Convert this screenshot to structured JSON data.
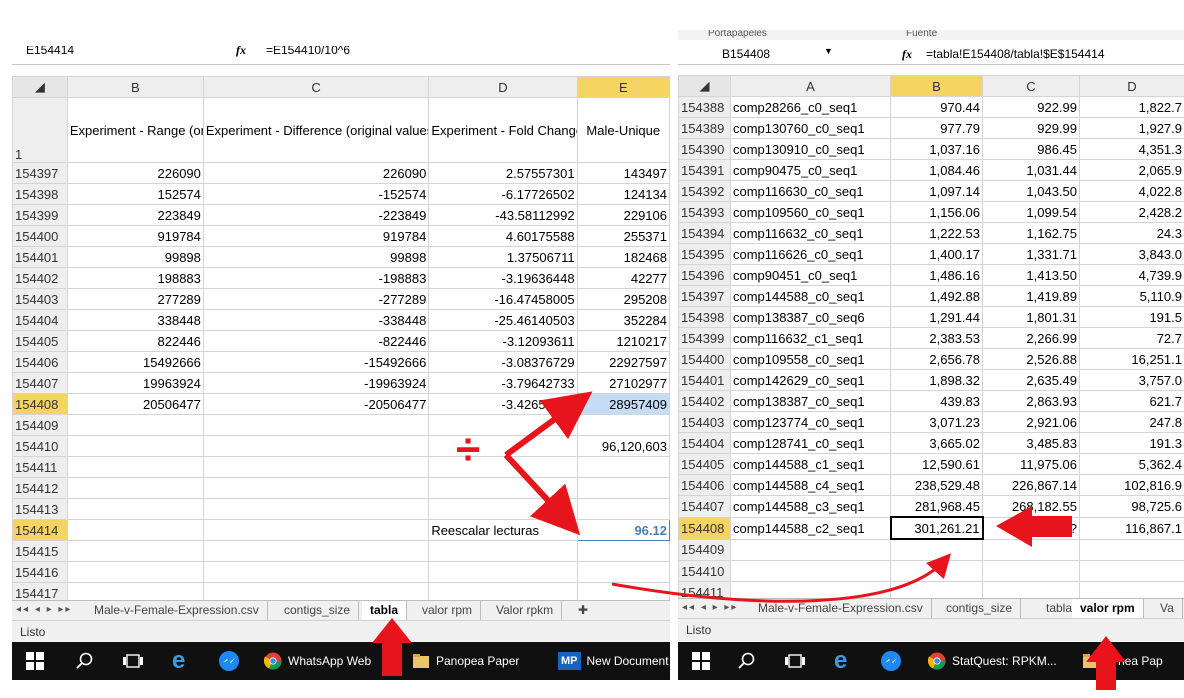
{
  "left": {
    "namebox": "E154414",
    "formula": "=E154410/10^6",
    "columns": [
      "B",
      "C",
      "D",
      "E"
    ],
    "header_row": {
      "num": "1",
      "B": "Experiment - Range (original values)",
      "C": "Experiment - Difference (original values)",
      "D": "Experiment - Fold Change (original values)",
      "E": "Male-Unique"
    },
    "rows": [
      {
        "n": "154397",
        "B": "226090",
        "C": "226090",
        "D": "2.57557301",
        "E": "143497"
      },
      {
        "n": "154398",
        "B": "152574",
        "C": "-152574",
        "D": "-6.17726502",
        "E": "124134"
      },
      {
        "n": "154399",
        "B": "223849",
        "C": "-223849",
        "D": "-43.58112992",
        "E": "229106"
      },
      {
        "n": "154400",
        "B": "919784",
        "C": "919784",
        "D": "4.60175588",
        "E": "255371"
      },
      {
        "n": "154401",
        "B": "99898",
        "C": "99898",
        "D": "1.37506711",
        "E": "182468"
      },
      {
        "n": "154402",
        "B": "198883",
        "C": "-198883",
        "D": "-3.19636448",
        "E": "42277"
      },
      {
        "n": "154403",
        "B": "277289",
        "C": "-277289",
        "D": "-16.47458005",
        "E": "295208"
      },
      {
        "n": "154404",
        "B": "338448",
        "C": "-338448",
        "D": "-25.46140503",
        "E": "352284"
      },
      {
        "n": "154405",
        "B": "822446",
        "C": "-822446",
        "D": "-3.12093611",
        "E": "1210217"
      },
      {
        "n": "154406",
        "B": "15492666",
        "C": "-15492666",
        "D": "-3.08376729",
        "E": "22927597"
      },
      {
        "n": "154407",
        "B": "19963924",
        "C": "-19963924",
        "D": "-3.79642733",
        "E": "27102977"
      },
      {
        "n": "154408",
        "B": "20506477",
        "C": "-20506477",
        "D": "-3.42653438",
        "E": "28957409"
      },
      {
        "n": "154409",
        "B": "",
        "C": "",
        "D": "",
        "E": ""
      },
      {
        "n": "154410",
        "B": "",
        "C": "",
        "D": "",
        "E": "96,120,603"
      },
      {
        "n": "154411",
        "B": "",
        "C": "",
        "D": "",
        "E": ""
      },
      {
        "n": "154412",
        "B": "",
        "C": "",
        "D": "",
        "E": ""
      },
      {
        "n": "154413",
        "B": "",
        "C": "",
        "D": "",
        "E": ""
      },
      {
        "n": "154414",
        "B": "",
        "C": "",
        "D": "Reescalar lecturas",
        "E": "96.12"
      },
      {
        "n": "154415",
        "B": "",
        "C": "",
        "D": "",
        "E": ""
      },
      {
        "n": "154416",
        "B": "",
        "C": "",
        "D": "",
        "E": ""
      },
      {
        "n": "154417",
        "B": "",
        "C": "",
        "D": "",
        "E": ""
      }
    ],
    "tabs": [
      "Male-v-Female-Expression.csv",
      "contigs_size",
      "tabla",
      "valor rpm",
      "Valor rpkm"
    ],
    "active_tab": "tabla",
    "status": "Listo",
    "divide_symbol": "÷"
  },
  "right": {
    "ribbon_labels": [
      "Portapapeles",
      "Fuente"
    ],
    "namebox": "B154408",
    "formula": "=tabla!E154408/tabla!$E$154414",
    "columns": [
      "A",
      "B",
      "C",
      "D"
    ],
    "rows": [
      {
        "n": "154388",
        "A": "comp28266_c0_seq1",
        "B": "970.44",
        "C": "922.99",
        "D": "1,822.7"
      },
      {
        "n": "154389",
        "A": "comp130760_c0_seq1",
        "B": "977.79",
        "C": "929.99",
        "D": "1,927.9"
      },
      {
        "n": "154390",
        "A": "comp130910_c0_seq1",
        "B": "1,037.16",
        "C": "986.45",
        "D": "4,351.3"
      },
      {
        "n": "154391",
        "A": "comp90475_c0_seq1",
        "B": "1,084.46",
        "C": "1,031.44",
        "D": "2,065.9"
      },
      {
        "n": "154392",
        "A": "comp116630_c0_seq1",
        "B": "1,097.14",
        "C": "1,043.50",
        "D": "4,022.8"
      },
      {
        "n": "154393",
        "A": "comp109560_c0_seq1",
        "B": "1,156.06",
        "C": "1,099.54",
        "D": "2,428.2"
      },
      {
        "n": "154394",
        "A": "comp116632_c0_seq1",
        "B": "1,222.53",
        "C": "1,162.75",
        "D": "24.3"
      },
      {
        "n": "154395",
        "A": "comp116626_c0_seq1",
        "B": "1,400.17",
        "C": "1,331.71",
        "D": "3,843.0"
      },
      {
        "n": "154396",
        "A": "comp90451_c0_seq1",
        "B": "1,486.16",
        "C": "1,413.50",
        "D": "4,739.9"
      },
      {
        "n": "154397",
        "A": "comp144588_c0_seq1",
        "B": "1,492.88",
        "C": "1,419.89",
        "D": "5,110.9"
      },
      {
        "n": "154398",
        "A": "comp138387_c0_seq6",
        "B": "1,291.44",
        "C": "1,801.31",
        "D": "191.5"
      },
      {
        "n": "154399",
        "A": "comp116632_c1_seq1",
        "B": "2,383.53",
        "C": "2,266.99",
        "D": "72.7"
      },
      {
        "n": "154400",
        "A": "comp109558_c0_seq1",
        "B": "2,656.78",
        "C": "2,526.88",
        "D": "16,251.1"
      },
      {
        "n": "154401",
        "A": "comp142629_c0_seq1",
        "B": "1,898.32",
        "C": "2,635.49",
        "D": "3,757.0"
      },
      {
        "n": "154402",
        "A": "comp138387_c0_seq1",
        "B": "439.83",
        "C": "2,863.93",
        "D": "621.7"
      },
      {
        "n": "154403",
        "A": "comp123774_c0_seq1",
        "B": "3,071.23",
        "C": "2,921.06",
        "D": "247.8"
      },
      {
        "n": "154404",
        "A": "comp128741_c0_seq1",
        "B": "3,665.02",
        "C": "3,485.83",
        "D": "191.3"
      },
      {
        "n": "154405",
        "A": "comp144588_c1_seq1",
        "B": "12,590.61",
        "C": "11,975.06",
        "D": "5,362.4"
      },
      {
        "n": "154406",
        "A": "comp144588_c4_seq1",
        "B": "238,529.48",
        "C": "226,867.14",
        "D": "102,816.9"
      },
      {
        "n": "154407",
        "A": "comp144588_c3_seq1",
        "B": "281,968.45",
        "C": "268,182.55",
        "D": "98,725.6"
      },
      {
        "n": "154408",
        "A": "comp144588_c2_seq1",
        "B": "301,261.21",
        "C": "286,??",
        "D": "116,867.1"
      },
      {
        "n": "154409",
        "A": "",
        "B": "",
        "C": "",
        "D": ""
      },
      {
        "n": "154410",
        "A": "",
        "B": "",
        "C": "",
        "D": ""
      },
      {
        "n": "154411",
        "A": "",
        "B": "",
        "C": "",
        "D": ""
      }
    ],
    "tabs": [
      "Male-v-Female-Expression.csv",
      "contigs_size",
      "tabla",
      "valor rpm",
      "Va"
    ],
    "active_tab": "valor rpm",
    "status": "Listo"
  },
  "taskbar_left": {
    "items": [
      "WhatsApp Web",
      "Panopea Paper",
      "New Document"
    ],
    "mp_badge": "MP"
  },
  "taskbar_right": {
    "items": [
      "StatQuest: RPKM...",
      "nea Pap"
    ]
  },
  "colors": {
    "arrow": "#e8141c",
    "header_sel": "#f5d462",
    "taskbar": "#101010",
    "link_blue": "#4a7ebb"
  }
}
